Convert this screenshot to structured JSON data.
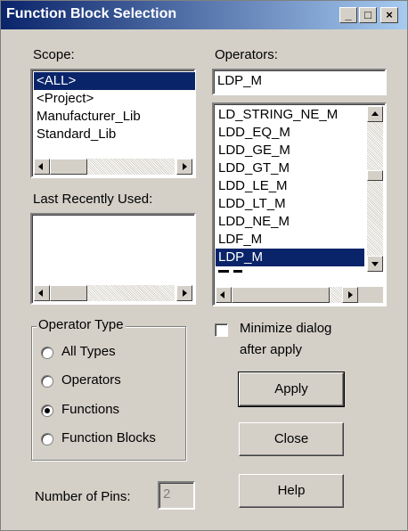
{
  "window": {
    "title": "Function Block Selection",
    "controls": {
      "minimize": "_",
      "maximize": "□",
      "close": "×"
    }
  },
  "scope": {
    "label": "Scope:",
    "items": [
      "<ALL>",
      "<Project>",
      "Manufacturer_Lib",
      "Standard_Lib"
    ],
    "selected_index": 0
  },
  "last_used": {
    "label": "Last Recently Used:",
    "items": []
  },
  "operators": {
    "label": "Operators:",
    "filter_value": "LDP_M",
    "items": [
      "LD_STRING_NE_M",
      "LDD_EQ_M",
      "LDD_GE_M",
      "LDD_GT_M",
      "LDD_LE_M",
      "LDD_LT_M",
      "LDD_NE_M",
      "LDF_M",
      "LDP_M"
    ],
    "selected_index": 8
  },
  "operator_type": {
    "label": "Operator Type",
    "options": [
      "All Types",
      "Operators",
      "Functions",
      "Function Blocks"
    ],
    "selected_index": 2
  },
  "minimize": {
    "label_line1": "Minimize dialog",
    "label_line2": "after apply",
    "checked": false
  },
  "buttons": {
    "apply": "Apply",
    "close": "Close",
    "help": "Help"
  },
  "pins": {
    "label": "Number of Pins:",
    "value": "2"
  },
  "colors": {
    "title_start": "#0a246a",
    "title_end": "#a6caf0",
    "face": "#d4d0c8",
    "selection": "#0a246a"
  }
}
